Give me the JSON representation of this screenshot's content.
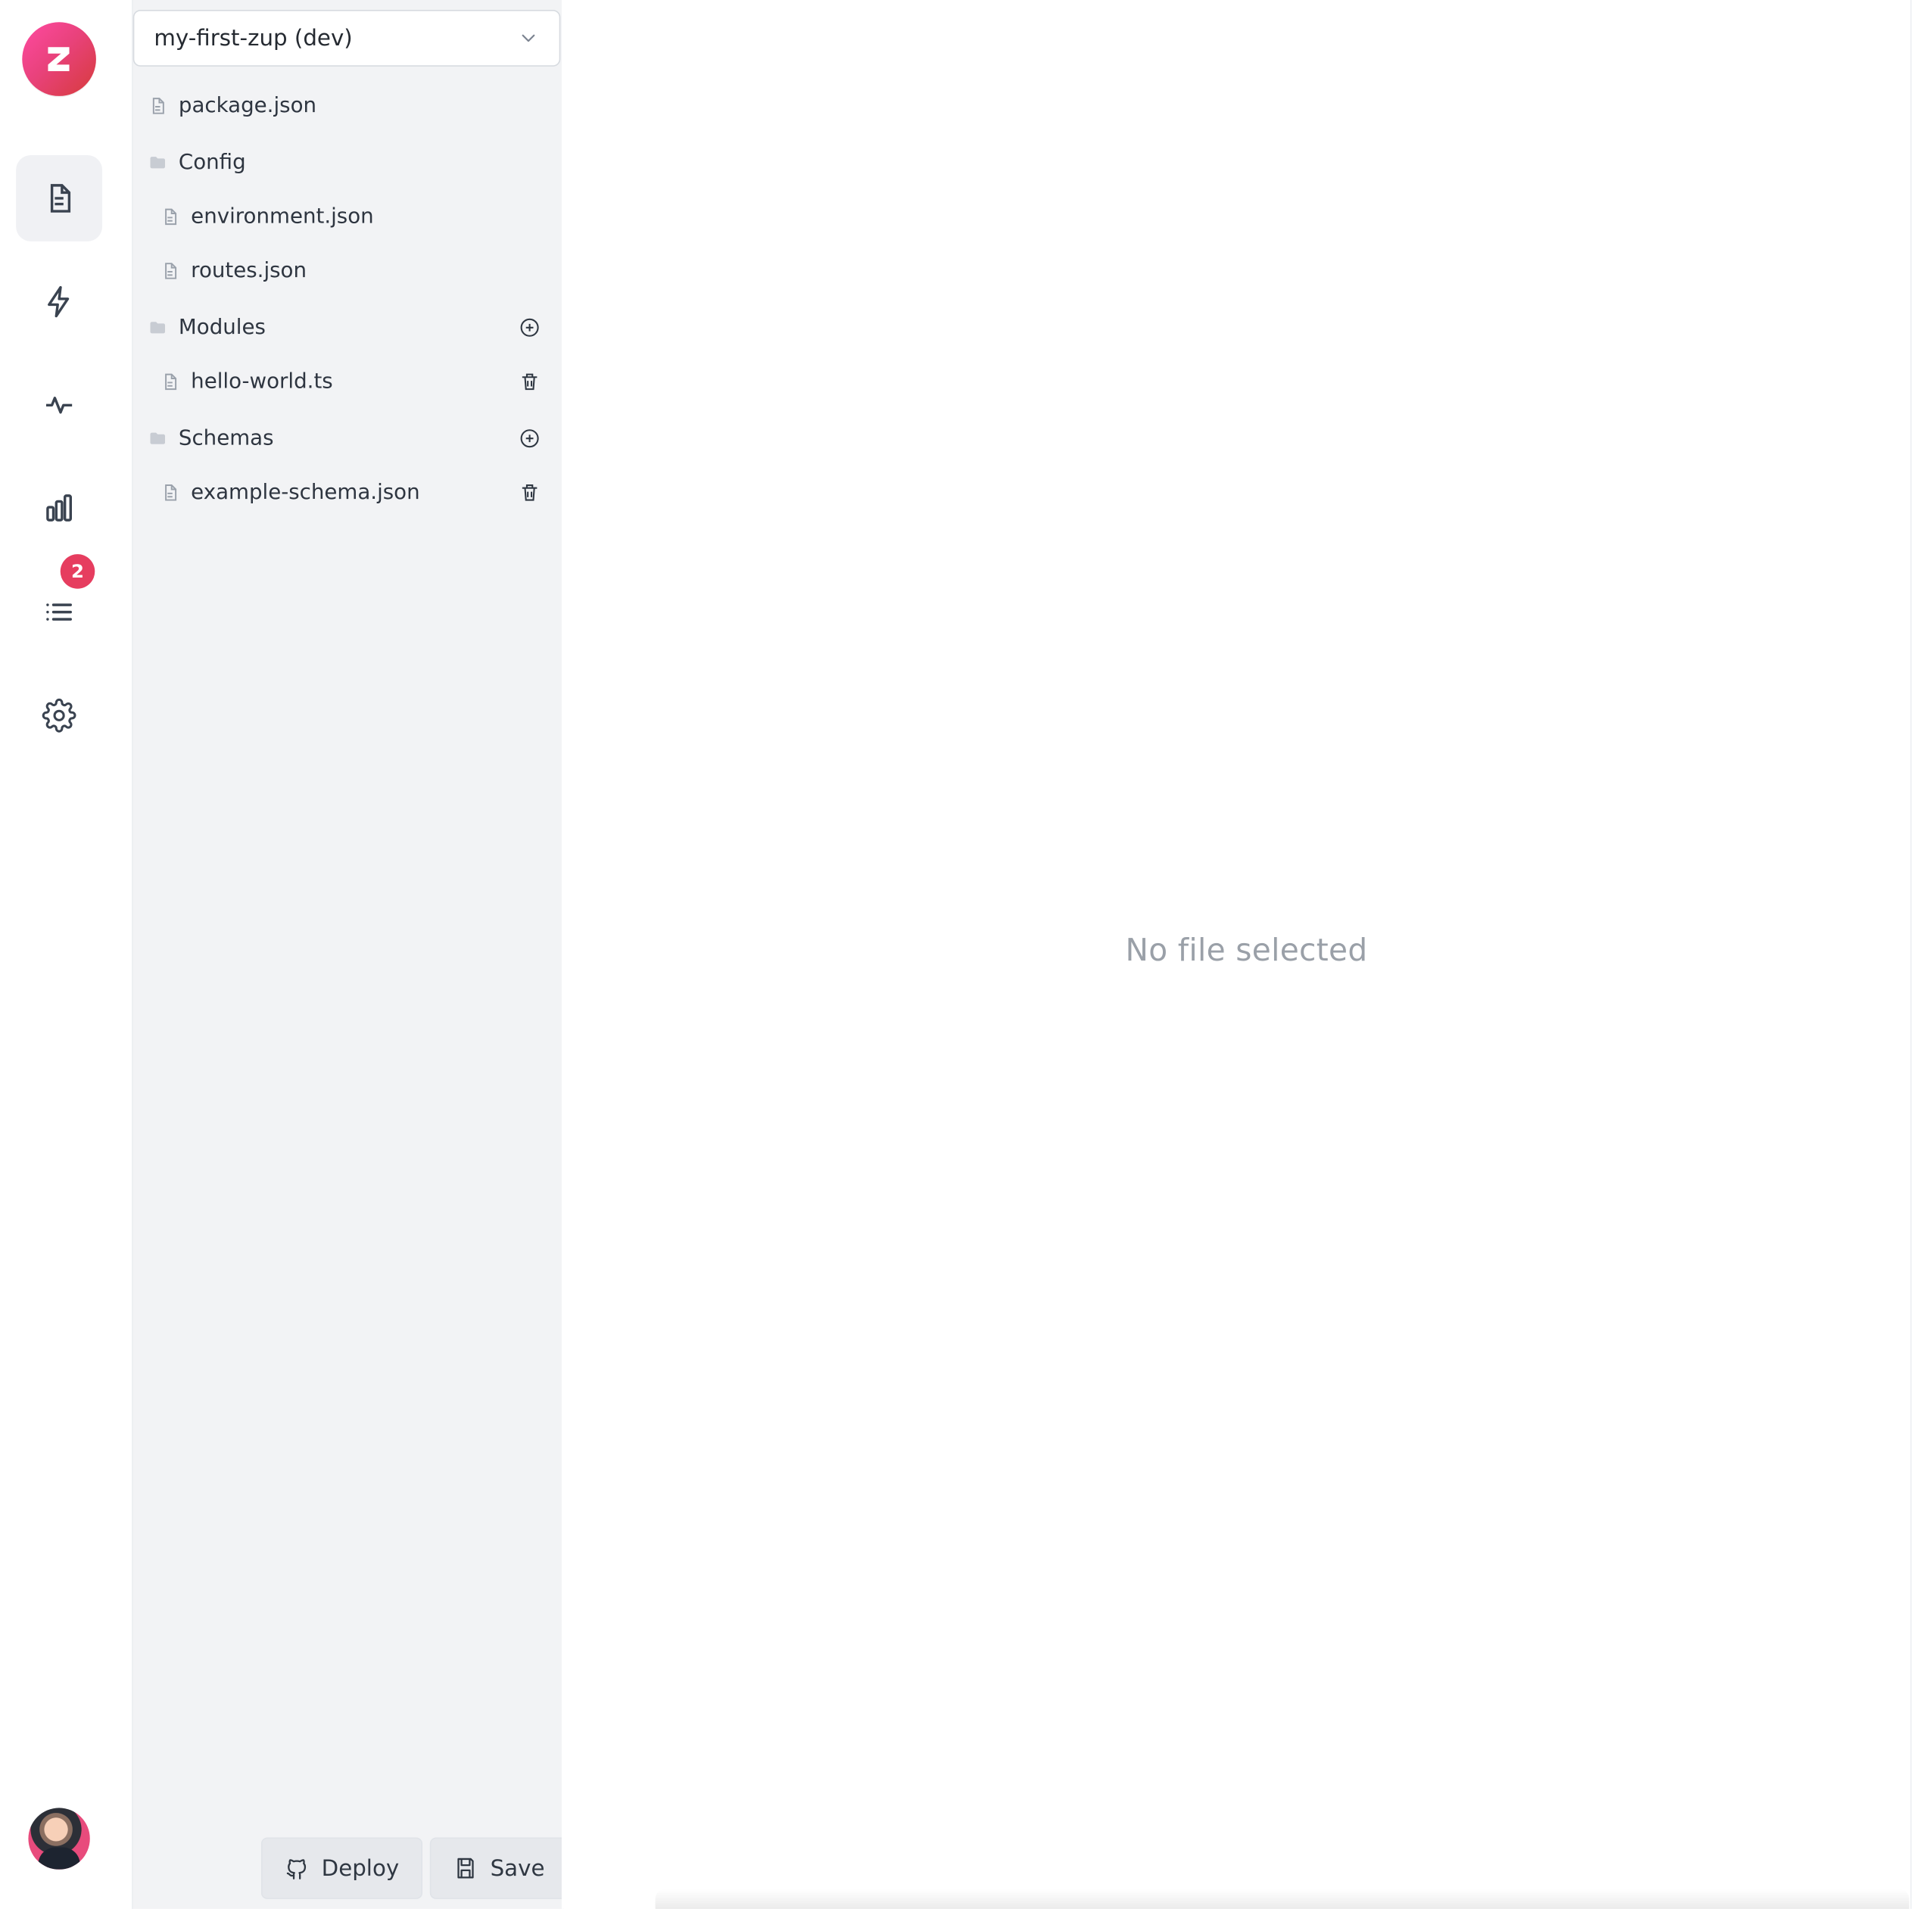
{
  "project_selector": {
    "value": "my-first-zup (dev)"
  },
  "rail": {
    "logo_letter": "Z",
    "notifications_count": "2",
    "icons": [
      "document-icon",
      "lightning-icon",
      "activity-icon",
      "bar-chart-icon",
      "list-icon",
      "gear-icon"
    ]
  },
  "tree": {
    "items": [
      {
        "type": "file",
        "label": "package.json",
        "level": 0
      },
      {
        "type": "folder",
        "label": "Config",
        "level": 0,
        "action": "none"
      },
      {
        "type": "file",
        "label": "environment.json",
        "level": 1
      },
      {
        "type": "file",
        "label": "routes.json",
        "level": 1
      },
      {
        "type": "folder",
        "label": "Modules",
        "level": 0,
        "action": "add"
      },
      {
        "type": "file",
        "label": "hello-world.ts",
        "level": 1,
        "action": "delete"
      },
      {
        "type": "folder",
        "label": "Schemas",
        "level": 0,
        "action": "add"
      },
      {
        "type": "file",
        "label": "example-schema.json",
        "level": 1,
        "action": "delete"
      }
    ]
  },
  "buttons": {
    "deploy": "Deploy",
    "save": "Save"
  },
  "main": {
    "empty_message": "No file selected"
  },
  "colors": {
    "sidebar_bg": "#f2f3f5",
    "accent_pink": "#e63d5f",
    "muted_text": "#9aa1ab"
  }
}
